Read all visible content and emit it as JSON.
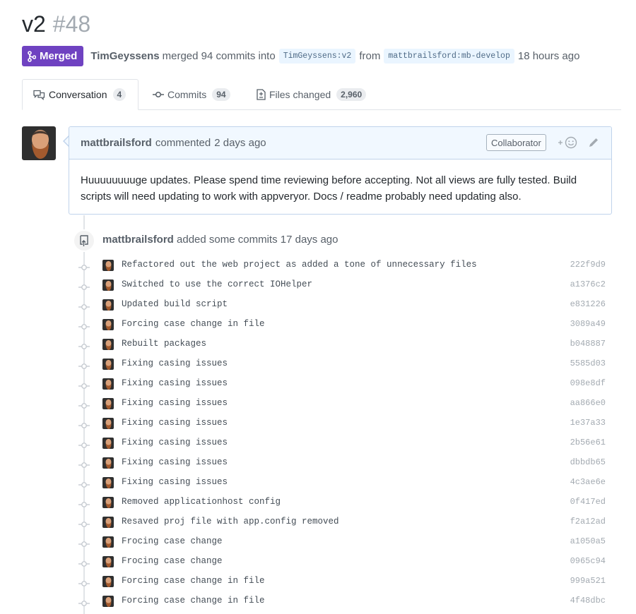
{
  "pr": {
    "title": "v2",
    "number": "#48",
    "state": "Merged",
    "author": "TimGeyssens",
    "action": "merged 94 commits into",
    "base_branch": "TimGeyssens:v2",
    "from_word": "from",
    "head_branch": "mattbrailsford:mb-develop",
    "time": "18 hours ago",
    "state_color": "#6f42c1"
  },
  "tabs": [
    {
      "label": "Conversation",
      "count": "4",
      "icon": "comment-discussion-icon",
      "selected": true
    },
    {
      "label": "Commits",
      "count": "94",
      "icon": "git-commit-icon",
      "selected": false
    },
    {
      "label": "Files changed",
      "count": "2,960",
      "icon": "file-diff-icon",
      "selected": false
    }
  ],
  "comment": {
    "author": "mattbrailsford",
    "action": "commented",
    "time": "2 days ago",
    "role_badge": "Collaborator",
    "body": "Huuuuuuuuge updates. Please spend time reviewing before accepting. Not all views are fully tested. Build scripts will need updating to work with appveryor. Docs / readme probably need updating also."
  },
  "commits_event": {
    "author": "mattbrailsford",
    "text": "added some commits",
    "time": "17 days ago"
  },
  "commits": [
    {
      "message": "Refactored out the web project as added a tone of unnecessary files",
      "sha": "222f9d9"
    },
    {
      "message": "Switched to use the correct IOHelper",
      "sha": "a1376c2"
    },
    {
      "message": "Updated build script",
      "sha": "e831226"
    },
    {
      "message": "Forcing case change in file",
      "sha": "3089a49"
    },
    {
      "message": "Rebuilt packages",
      "sha": "b048887"
    },
    {
      "message": "Fixing casing issues",
      "sha": "5585d03"
    },
    {
      "message": "Fixing casing issues",
      "sha": "098e8df"
    },
    {
      "message": "Fixing casing issues",
      "sha": "aa866e0"
    },
    {
      "message": "Fixing casing issues",
      "sha": "1e37a33"
    },
    {
      "message": "Fixing casing issues",
      "sha": "2b56e61"
    },
    {
      "message": "Fixing casing issues",
      "sha": "dbbdb65"
    },
    {
      "message": "Fixing casing issues",
      "sha": "4c3ae6e"
    },
    {
      "message": "Removed applicationhost config",
      "sha": "0f417ed"
    },
    {
      "message": "Resaved proj file with app.config removed",
      "sha": "f2a12ad"
    },
    {
      "message": "Frocing case change",
      "sha": "a1050a5"
    },
    {
      "message": "Frocing case change",
      "sha": "0965c94"
    },
    {
      "message": "Forcing case change in file",
      "sha": "999a521"
    },
    {
      "message": "Forcing case change in file",
      "sha": "4f48dbc"
    }
  ]
}
